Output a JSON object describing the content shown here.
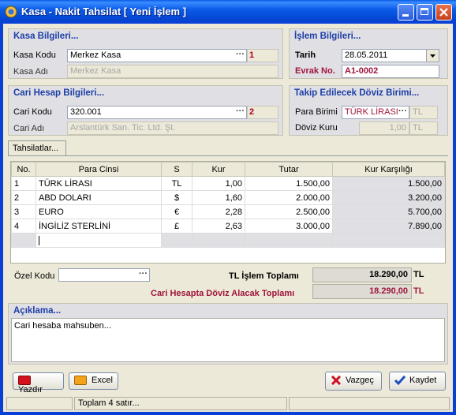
{
  "window": {
    "title": "Kasa - Nakit Tahsilat   [ Yeni İşlem ]"
  },
  "kasa": {
    "section_title": "Kasa Bilgileri...",
    "kod_label": "Kasa Kodu",
    "kod_value": "Merkez Kasa",
    "kod_badge": "1",
    "ad_label": "Kasa Adı",
    "ad_value": "Merkez Kasa"
  },
  "islem": {
    "section_title": "İşlem Bilgileri...",
    "tarih_label": "Tarih",
    "tarih_value": "28.05.2011",
    "evrak_label": "Evrak No.",
    "evrak_value": "A1-0002"
  },
  "cari": {
    "section_title": "Cari Hesap Bilgileri...",
    "kod_label": "Cari Kodu",
    "kod_value": "320.001",
    "kod_badge": "2",
    "ad_label": "Cari Adı",
    "ad_value": "Arslantürk San. Tic. Ltd. Şt."
  },
  "doviz": {
    "section_title": "Takip Edilecek Döviz Birimi...",
    "para_label": "Para Birimi",
    "para_value": "TÜRK LİRASI",
    "para_unit": "TL",
    "kur_label": "Döviz Kuru",
    "kur_value": "1,00",
    "kur_unit": "TL"
  },
  "tab": {
    "label": "Tahsilatlar..."
  },
  "grid": {
    "columns": [
      "No.",
      "Para Cinsi",
      "S",
      "Kur",
      "Tutar",
      "Kur Karşılığı"
    ],
    "rows": [
      [
        "1",
        "TÜRK LİRASI",
        "TL",
        "1,00",
        "1.500,00",
        "1.500,00"
      ],
      [
        "2",
        "ABD DOLARI",
        "$",
        "1,60",
        "2.000,00",
        "3.200,00"
      ],
      [
        "3",
        "EURO",
        "€",
        "2,28",
        "2.500,00",
        "5.700,00"
      ],
      [
        "4",
        "İNGİLİZ STERLİNİ",
        "£",
        "2,63",
        "3.000,00",
        "7.890,00"
      ]
    ]
  },
  "footer": {
    "ozel_kod_label": "Özel Kodu",
    "tl_total_label": "TL İşlem Toplamı",
    "tl_total_value": "18.290,00",
    "tl_total_unit": "TL",
    "cari_total_label": "Cari Hesapta Döviz Alacak Toplamı",
    "cari_total_value": "18.290,00",
    "cari_total_unit": "TL"
  },
  "aciklama": {
    "section_title": "Açıklama...",
    "text": "Cari hesaba mahsuben..."
  },
  "buttons": {
    "yazdir": "Yazdır",
    "excel": "Excel",
    "vazgec": "Vazgeç",
    "kaydet": "Kaydet"
  },
  "status": {
    "text": "Toplam 4 satır..."
  },
  "colors": {
    "title_blue": "#0a5ce8",
    "section_title": "#1c3ea8",
    "accent_red": "#a0143c"
  }
}
